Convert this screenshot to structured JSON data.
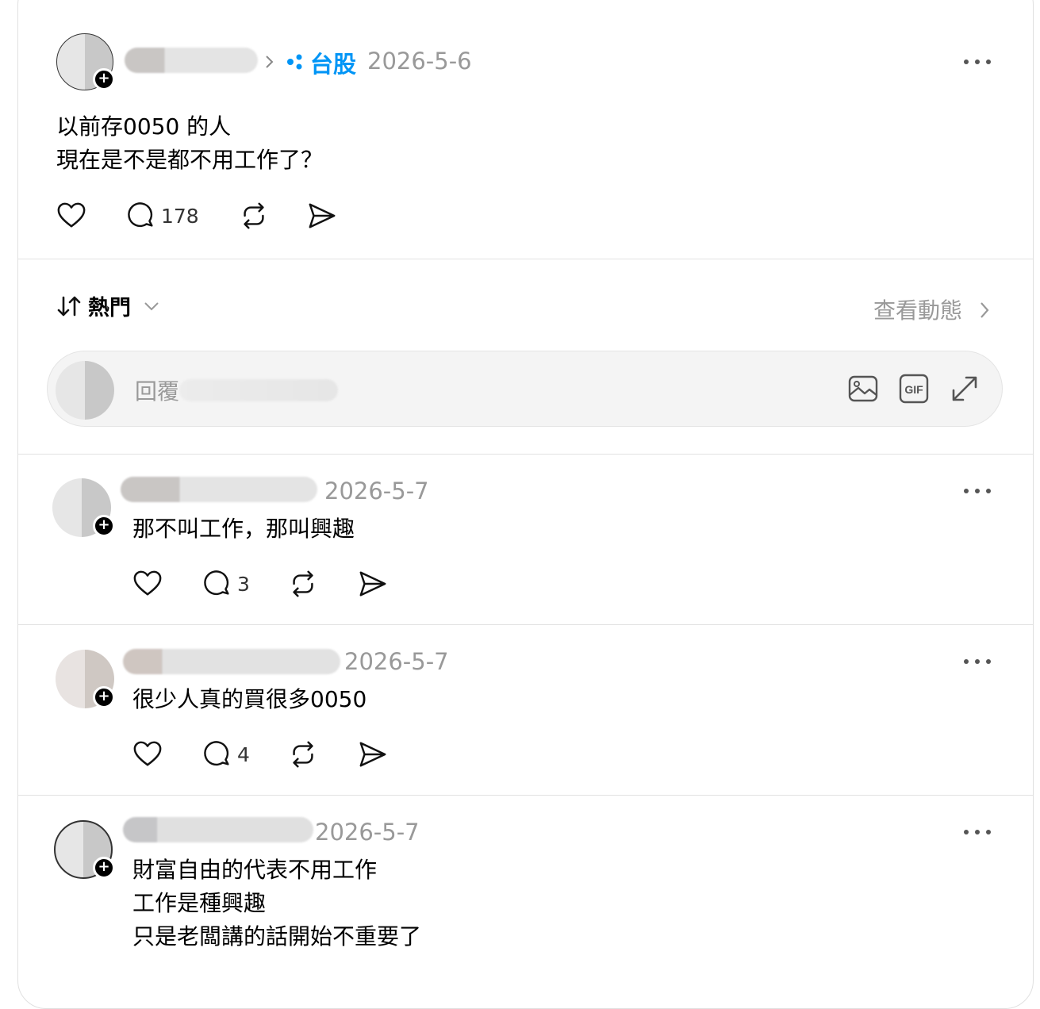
{
  "post": {
    "topic_label": "台股",
    "date": "2026-5-6",
    "lines": [
      "以前存0050 的人",
      "現在是不是都不用工作了？"
    ],
    "reply_count": "178"
  },
  "sort": {
    "label": "熱門",
    "activity_link": "查看動態"
  },
  "composer": {
    "placeholder": "回覆"
  },
  "replies": [
    {
      "date": "2026-5-7",
      "text": "那不叫工作，那叫興趣",
      "reply_count": "3"
    },
    {
      "date": "2026-5-7",
      "text": "很少人真的買很多0050",
      "reply_count": "4"
    },
    {
      "date": "2026-5-7",
      "text": "財富自由的代表不用工作\n工作是種興趣\n只是老闆講的話開始不重要了"
    }
  ],
  "colors": {
    "accent": "#0095f6",
    "muted": "#999999",
    "text": "#000000",
    "divider": "#e2e2e2"
  },
  "icons": [
    "heart-icon",
    "comment-icon",
    "repost-icon",
    "share-icon",
    "more-icon",
    "chevron-right-icon",
    "chevron-down-icon",
    "sort-icon",
    "image-icon",
    "gif-icon",
    "expand-icon",
    "topic-dots-icon",
    "follow-plus-icon"
  ]
}
